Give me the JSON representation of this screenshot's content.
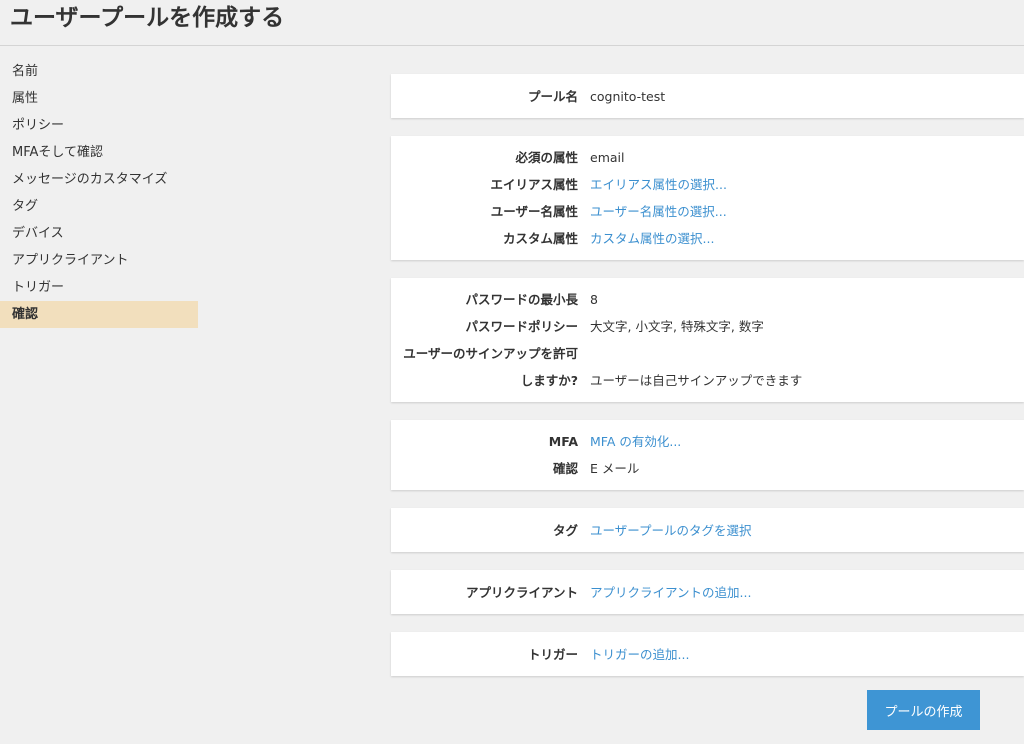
{
  "header": {
    "title": "ユーザープールを作成する"
  },
  "sidebar": {
    "items": [
      {
        "label": "名前"
      },
      {
        "label": "属性"
      },
      {
        "label": "ポリシー"
      },
      {
        "label": "MFAそして確認"
      },
      {
        "label": "メッセージのカスタマイズ"
      },
      {
        "label": "タグ"
      },
      {
        "label": "デバイス"
      },
      {
        "label": "アプリクライアント"
      },
      {
        "label": "トリガー"
      },
      {
        "label": "確認",
        "active": true
      }
    ]
  },
  "review": {
    "pool": {
      "name_label": "プール名",
      "name_value": "cognito-test"
    },
    "attributes": {
      "required_label": "必須の属性",
      "required_value": "email",
      "alias_label": "エイリアス属性",
      "alias_link": "エイリアス属性の選択...",
      "username_label": "ユーザー名属性",
      "username_link": "ユーザー名属性の選択...",
      "custom_label": "カスタム属性",
      "custom_link": "カスタム属性の選択..."
    },
    "policies": {
      "min_length_label": "パスワードの最小長",
      "min_length_value": "8",
      "policy_label": "パスワードポリシー",
      "policy_value": "大文字, 小文字, 特殊文字, 数字",
      "signup_label_line1": "ユーザーのサインアップを許可",
      "signup_label_line2": "しますか?",
      "signup_value": "ユーザーは自己サインアップできます"
    },
    "mfa": {
      "mfa_label": "MFA",
      "mfa_link": "MFA の有効化...",
      "verification_label": "確認",
      "verification_value": "E メール"
    },
    "tags": {
      "label": "タグ",
      "link": "ユーザープールのタグを選択"
    },
    "app_clients": {
      "label": "アプリクライアント",
      "link": "アプリクライアントの追加..."
    },
    "triggers": {
      "label": "トリガー",
      "link": "トリガーの追加..."
    }
  },
  "actions": {
    "create_label": "プールの作成"
  },
  "colors": {
    "link": "#3b8fcf",
    "active_nav": "#f2dfbd",
    "primary_button": "#3e95d4",
    "background": "#f0f0f0"
  }
}
